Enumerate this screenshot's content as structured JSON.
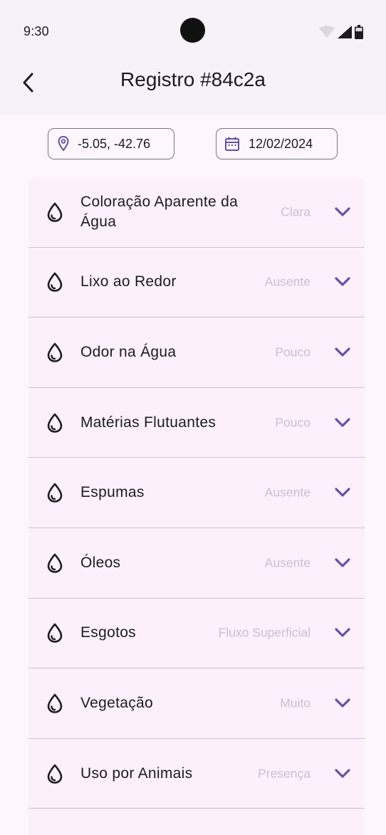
{
  "status_bar": {
    "time": "9:30"
  },
  "app_bar": {
    "title": "Registro #84c2a"
  },
  "chips": {
    "location": "-5.05, -42.76",
    "date": "12/02/2024"
  },
  "items": [
    {
      "label": "Coloração Aparente da Água",
      "value": "Clara"
    },
    {
      "label": "Lixo ao Redor",
      "value": "Ausente"
    },
    {
      "label": "Odor na Água",
      "value": "Pouco"
    },
    {
      "label": "Matérias Flutuantes",
      "value": "Pouco"
    },
    {
      "label": "Espumas",
      "value": "Ausente"
    },
    {
      "label": "Óleos",
      "value": "Ausente"
    },
    {
      "label": "Esgotos",
      "value": "Fluxo Superficial"
    },
    {
      "label": "Vegetação",
      "value": "Muito"
    },
    {
      "label": "Uso por Animais",
      "value": "Presença"
    }
  ],
  "colors": {
    "accent": "#6750a4",
    "value_text": "#c9bfd1",
    "surface": "#fbf0fb"
  },
  "icons": {
    "item_icon": "water-drop-icon",
    "expand": "chevron-down-icon"
  }
}
